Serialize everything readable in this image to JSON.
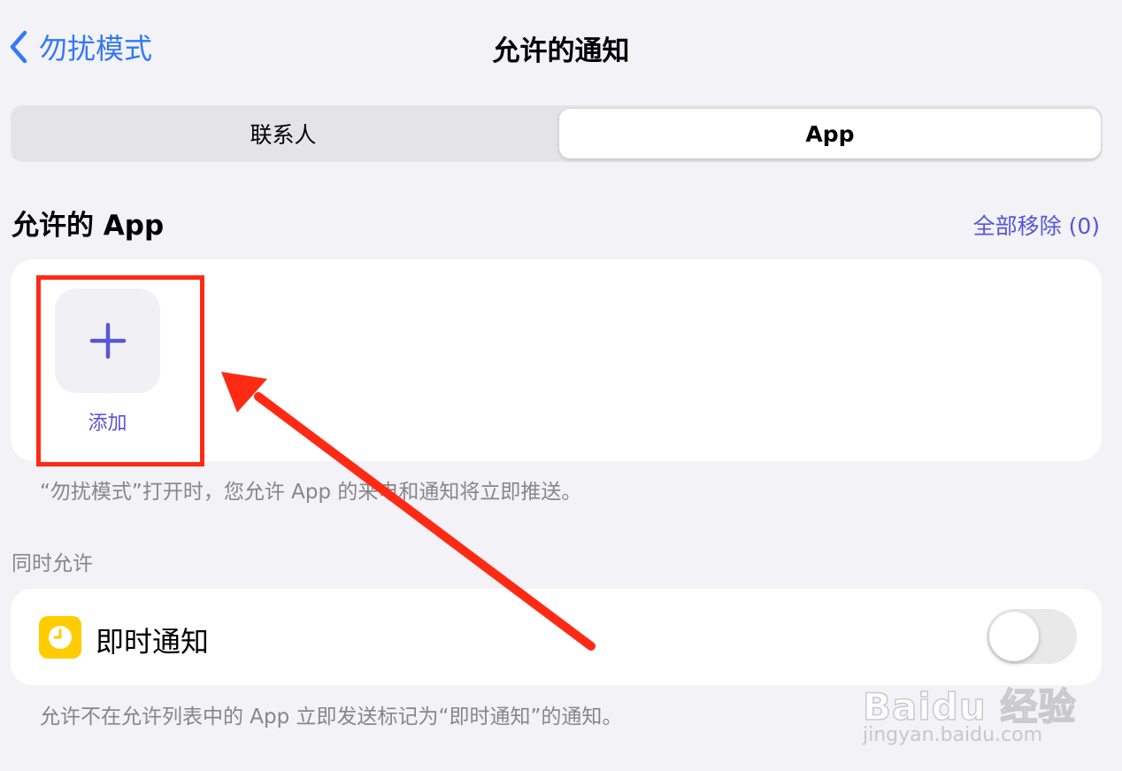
{
  "nav": {
    "back_label": "勿扰模式",
    "title": "允许的通知"
  },
  "segmented": {
    "left_label": "联系人",
    "right_label": "App",
    "selected": "App"
  },
  "allowed_apps": {
    "header": "允许的 App",
    "remove_all": "全部移除 (0)",
    "add_label": "添加",
    "footnote": "“勿扰模式”打开时，您允许 App 的来电和通知将立即推送。"
  },
  "also_allow": {
    "header": "同时允许",
    "time_sensitive_label": "即时通知",
    "toggle_on": false,
    "footnote": "允许不在允许列表中的 App 立即发送标记为“即时通知”的通知。"
  },
  "annotation": {
    "highlight_color": "#ff2a14"
  },
  "watermark": {
    "brand": "Baidu 经验",
    "url": "jingyan.baidu.com"
  },
  "colors": {
    "accent_blue": "#3478f6",
    "accent_purple": "#5856d6",
    "icon_yellow": "#ffcc00"
  }
}
